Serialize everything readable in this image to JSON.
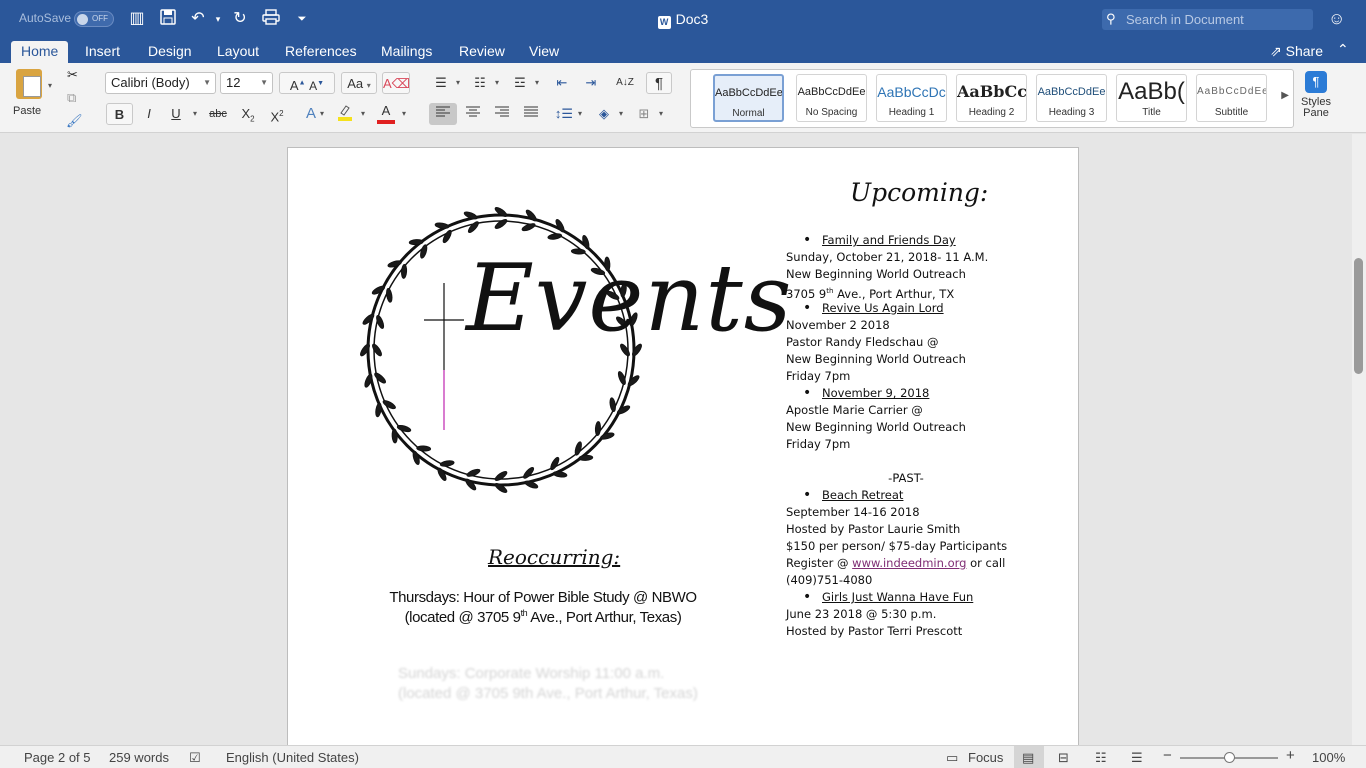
{
  "titlebar": {
    "autosave": "AutoSave",
    "autosave_state": "OFF",
    "document_title": "Doc3",
    "search_placeholder": "Search in Document"
  },
  "tabs": [
    "Home",
    "Insert",
    "Design",
    "Layout",
    "References",
    "Mailings",
    "Review",
    "View"
  ],
  "share_label": "Share",
  "ribbon": {
    "paste_label": "Paste",
    "font_name": "Calibri (Body)",
    "font_size": "12",
    "styles": [
      {
        "sample": "AaBbCcDdEe",
        "name": "Normal"
      },
      {
        "sample": "AaBbCcDdEe",
        "name": "No Spacing"
      },
      {
        "sample": "AaBbCcDc",
        "name": "Heading 1"
      },
      {
        "sample": "AaBbCc",
        "name": "Heading 2"
      },
      {
        "sample": "AaBbCcDdEe",
        "name": "Heading 3"
      },
      {
        "sample": "AaBb(",
        "name": "Title"
      },
      {
        "sample": "AaBbCcDdEe",
        "name": "Subtitle"
      }
    ],
    "styles_pane": "Styles Pane"
  },
  "document": {
    "events_word": "Events",
    "reoccurring_title": "Reoccurring:",
    "reoccurring_line1": "Thursdays: Hour of Power Bible Study @ NBWO",
    "reoccurring_line2_a": "(located @ 3705 9",
    "reoccurring_line2_sup": "th",
    "reoccurring_line2_b": " Ave., Port Arthur, Texas)",
    "ghost_line1": "Sundays: Corporate Worship 11:00 a.m.",
    "ghost_line2": "(located @ 3705 9th Ave., Port Arthur, Texas)",
    "upcoming_title": "Upcoming:",
    "upcoming": {
      "e1_title": "Family and Friends Day",
      "e1_l1": "Sunday, October 21, 2018- 11 A.M.",
      "e1_l2": "New Beginning World Outreach",
      "e1_l3a": "3705 9",
      "e1_l3sup": "th",
      "e1_l3b": " Ave., Port Arthur, TX",
      "e2_title": "Revive Us Again Lord",
      "e2_l1": "November 2 2018",
      "e2_l2": "Pastor Randy Fledschau @",
      "e2_l3": "New Beginning World Outreach",
      "e2_l4": "Friday 7pm",
      "e3_title": "November 9, 2018",
      "e3_l1": "Apostle Marie Carrier @",
      "e3_l2": "New Beginning World Outreach",
      "e3_l3": "Friday 7pm"
    },
    "past_heading": "-PAST-",
    "past": {
      "p1_title": "Beach Retreat",
      "p1_l1": "September 14-16 2018",
      "p1_l2": "Hosted by Pastor Laurie Smith",
      "p1_l3": "$150 per person/ $75-day Participants",
      "p1_l4_pre": "Register @ ",
      "p1_link": "www.indeedmin.org",
      "p1_l4_post": " or call",
      "p1_l5": "(409)751-4080",
      "p2_title": "Girls Just Wanna Have Fun",
      "p2_l1": "June 23 2018 @ 5:30 p.m.",
      "p2_l2": "Hosted by Pastor Terri Prescott"
    }
  },
  "statusbar": {
    "page": "Page 2 of 5",
    "words": "259 words",
    "language": "English (United States)",
    "focus": "Focus",
    "zoom": "100%"
  }
}
